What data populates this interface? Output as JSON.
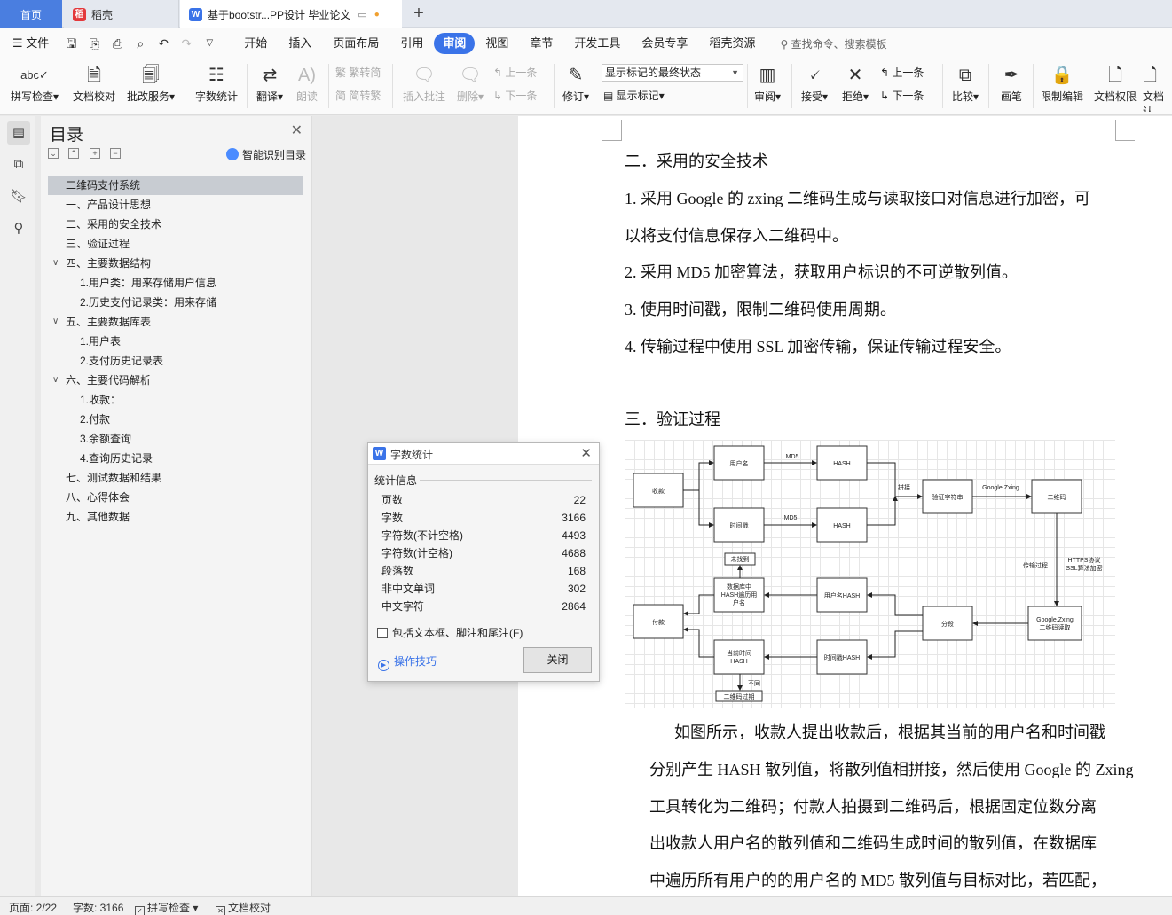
{
  "tabs": {
    "home": "首页",
    "daoke": "稻壳",
    "doc": "基于bootstr...PP设计 毕业论文"
  },
  "menu": {
    "file": "文件",
    "items": [
      "开始",
      "插入",
      "页面布局",
      "引用",
      "审阅",
      "视图",
      "章节",
      "开发工具",
      "会员专享",
      "稻壳资源"
    ],
    "active": "审阅",
    "search": "查找命令、搜索模板"
  },
  "ribbon": {
    "spell": "拼写检查",
    "doc_check": "文档校对",
    "review_service": "批改服务",
    "word_count": "字数统计",
    "translate": "翻译",
    "read_aloud": "朗读",
    "simp_to_trad": "繁转简",
    "trad_to_simp": "简转繁",
    "insert_comment": "插入批注",
    "delete": "删除",
    "prev_comment": "上一条",
    "next_comment": "下一条",
    "track": "修订",
    "markup_state": "显示标记的最终状态",
    "show_markup": "显示标记",
    "review": "审阅",
    "accept": "接受",
    "reject": "拒绝",
    "prev": "上一条",
    "next": "下一条",
    "compare": "比较",
    "pen": "画笔",
    "restrict_edit": "限制编辑",
    "doc_perm": "文档权限",
    "doc_cert": "文档认"
  },
  "toc": {
    "title": "目录",
    "smart": "智能识别目录",
    "items": [
      "二维码支付系统",
      "一、产品设计思想",
      "二、采用的安全技术",
      "三、验证过程",
      "四、主要数据结构",
      "1.用户类：用来存储用户信息",
      "2.历史支付记录类：用来存储",
      "五、主要数据库表",
      "1.用户表",
      "2.支付历史记录表",
      "六、主要代码解析",
      "1.收款：",
      "2.付款",
      "3.余额查询",
      "4.查询历史记录",
      "七、测试数据和结果",
      "八、心得体会",
      "九、其他数据"
    ]
  },
  "doc": {
    "heading2": "二．采用的安全技术",
    "p1a": "1.  采用 Google 的 zxing 二维码生成与读取接口对信息进行加密，可",
    "p1b": "以将支付信息保存入二维码中。",
    "p2": "2.  采用 MD5 加密算法，获取用户标识的不可逆散列值。",
    "p3": "3.  使用时间戳，限制二维码使用周期。",
    "p4": "4.  传输过程中使用 SSL 加密传输，保证传输过程安全。",
    "heading3": "三．验证过程",
    "body": [
      "如图所示，收款人提出收款后，根据其当前的用户名和时间戳",
      "分别产生 HASH 散列值，将散列值相拼接，然后使用 Google 的 Zxing",
      "工具转化为二维码；付款人拍摄到二维码后，根据固定位数分离",
      "出收款人用户名的散列值和二维码生成时间的散列值，在数据库",
      "中遍历所有用户的的用户名的 MD5 散列值与目标对比，若匹配，"
    ]
  },
  "flow": {
    "collect": "收款",
    "username": "用户名",
    "timestamp": "时间戳",
    "hash1": "HASH",
    "hash2": "HASH",
    "md5a": "MD5",
    "md5b": "MD5",
    "concat": "拼接",
    "verify_str": "验证字符串",
    "google_zxing": "Google.Zxing",
    "qrcode": "二维码",
    "transmit": "传输过程",
    "https1": "HTTPS协议",
    "https2": "SSL算法加密",
    "gz_read1": "Google.Zxing",
    "gz_read2": "二维码读取",
    "split": "分段",
    "user_hash": "用户名HASH",
    "time_hash": "时间戳HASH",
    "db1": "数据库中",
    "db2": "HASH遍历用",
    "db3": "户名",
    "not_found": "未找到",
    "pay": "付款",
    "cur1": "当前时间",
    "cur2": "HASH",
    "differ": "不同",
    "expired": "二维码过期"
  },
  "dialog": {
    "title": "字数统计",
    "section": "统计信息",
    "rows": [
      {
        "label": "页数",
        "value": "22"
      },
      {
        "label": "字数",
        "value": "3166"
      },
      {
        "label": "字符数(不计空格)",
        "value": "4493"
      },
      {
        "label": "字符数(计空格)",
        "value": "4688"
      },
      {
        "label": "段落数",
        "value": "168"
      },
      {
        "label": "非中文单词",
        "value": "302"
      },
      {
        "label": "中文字符",
        "value": "2864"
      }
    ],
    "include": "包括文本框、脚注和尾注(F)",
    "tips": "操作技巧",
    "close": "关闭"
  },
  "status": {
    "page": "页面: 2/22",
    "words": "字数: 3166",
    "spell": "拼写检查",
    "doc_check": "文档校对"
  }
}
